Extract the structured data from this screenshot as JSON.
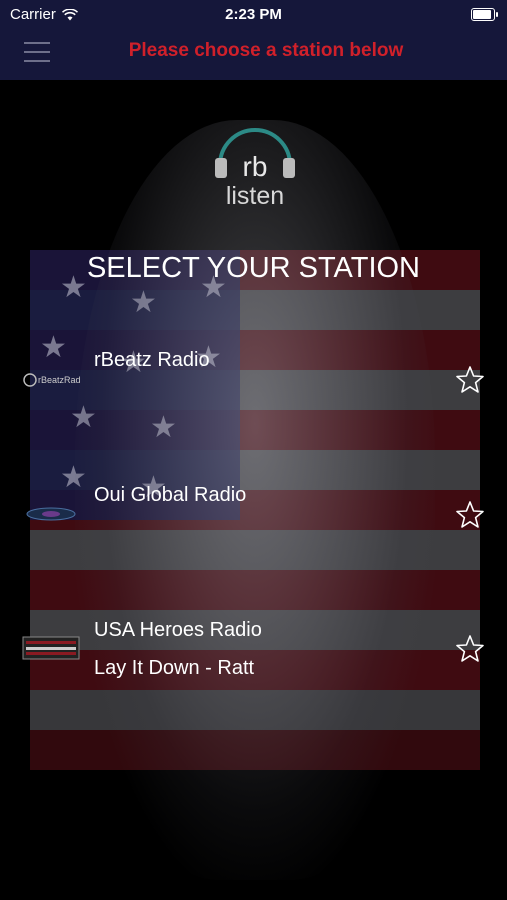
{
  "status": {
    "carrier": "Carrier",
    "time": "2:23 PM",
    "battery_level": 1.0
  },
  "nav": {
    "title": "Please choose a station below"
  },
  "logo": {
    "text": "listen",
    "letters": "rb"
  },
  "heading": "SELECT YOUR STATION",
  "stations": [
    {
      "name": "rBeatz Radio",
      "thumb_label": "rBeatzRadio",
      "now_playing": ""
    },
    {
      "name": "Oui Global Radio",
      "thumb_label": "",
      "now_playing": ""
    },
    {
      "name": "USA Heroes Radio",
      "thumb_label": "",
      "now_playing": "Lay It Down - Ratt"
    }
  ],
  "colors": {
    "nav_bg": "#15173a",
    "title": "#d0202a",
    "text": "#ffffff"
  }
}
